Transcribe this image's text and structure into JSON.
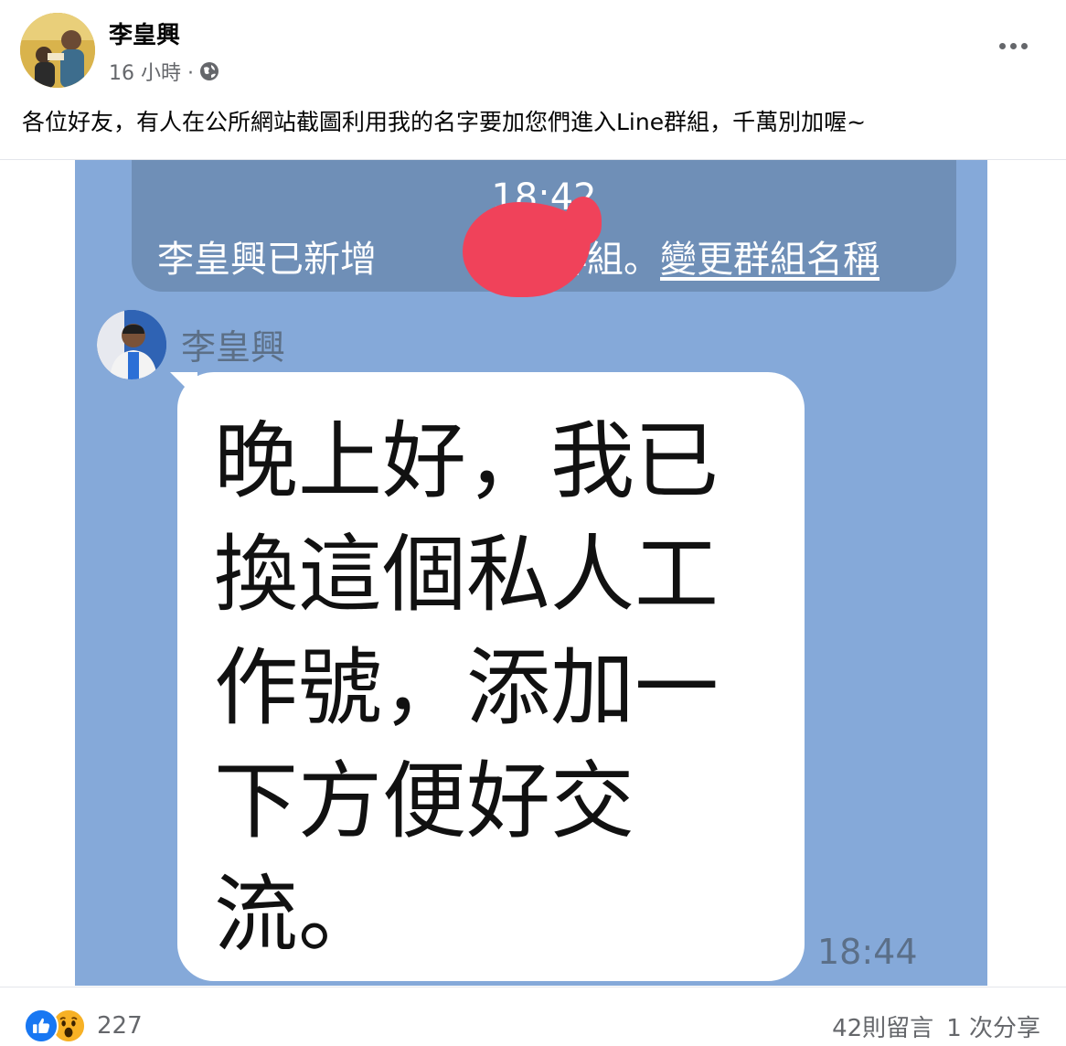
{
  "post": {
    "author": "李皇興",
    "timestamp": "16 小時 ·",
    "text": "各位好友，有人在公所網站截圖利用我的名字要加您們進入Line群組，千萬別加喔~"
  },
  "screenshot": {
    "system_time": "18:42",
    "system_prefix": "李皇興已新增",
    "system_suffix": "至群組。",
    "system_link": "變更群組名稱",
    "sender_name": "李皇興",
    "message": "晚上好，我已換這個私人工作號，添加一下方便好交流。",
    "message_time": "18:44"
  },
  "footer": {
    "reaction_count": "227",
    "comments": "42則留言",
    "shares": "1 次分享"
  },
  "icons": {
    "more": "more-horizontal-icon",
    "privacy": "globe-icon",
    "reactions": [
      "like-icon",
      "wow-icon"
    ]
  },
  "colors": {
    "photo_background": "#85a9d9",
    "system_bubble": "#6f8fb7",
    "redaction": "#f0425a",
    "like_blue": "#1877f2",
    "wow_yellow": "#f7b125"
  }
}
